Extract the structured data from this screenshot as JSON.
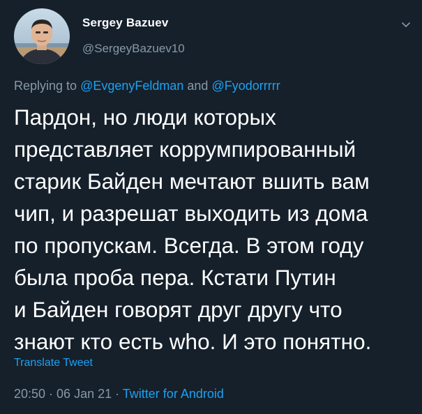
{
  "author": {
    "display_name": "Sergey Bazuev",
    "handle": "@SergeyBazuev10",
    "avatar_icon": "user-avatar-photo"
  },
  "menu_icon": "chevron-down-icon",
  "reply": {
    "prefix": "Replying to ",
    "mention_1": "@EvgenyFeldman",
    "connector": " and ",
    "mention_2": "@Fyodorrrrr"
  },
  "tweet": {
    "text": "Пардон, но люди которых\nпредставляет коррумпированный\nстарик Байден мечтают вшить вам\nчип, и разрешат выходить из дома\nпо пропускам. Всегда. В этом году\nбыла проба пера. Кстати Путин\nи Байден говорят друг другу что\nзнают кто есть who. И это понятно."
  },
  "translate_label": "Translate Tweet",
  "meta": {
    "time": "20:50",
    "separator_1": " · ",
    "date": "06 Jan 21",
    "separator_2": " · ",
    "source": "Twitter for Android"
  },
  "colors": {
    "background": "#15202b",
    "text": "#ffffff",
    "muted": "#8899a6",
    "accent": "#1da1f2"
  }
}
